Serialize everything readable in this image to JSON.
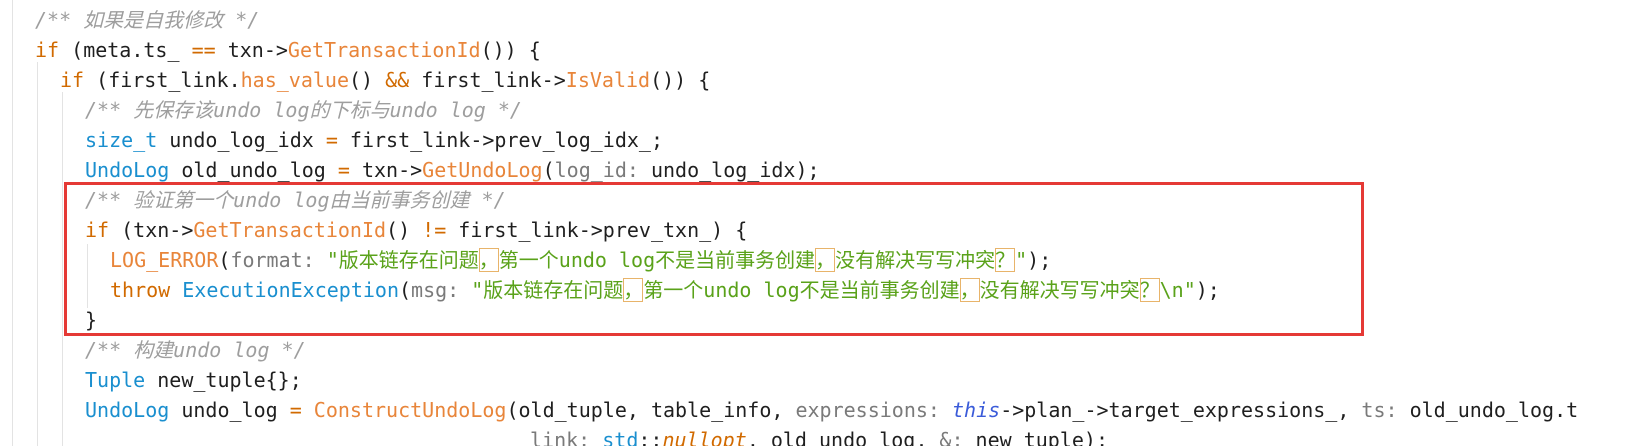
{
  "editor": {
    "lines": [
      [
        {
          "c": "tok-comment",
          "t": "/** 如果是自我修改 */"
        }
      ],
      [
        {
          "c": "tok-kw",
          "t": "if"
        },
        {
          "c": "tok-punct",
          "t": " ("
        },
        {
          "c": "tok-var",
          "t": "meta.ts_ "
        },
        {
          "c": "tok-op",
          "t": "=="
        },
        {
          "c": "tok-var",
          "t": " txn->"
        },
        {
          "c": "tok-fn",
          "t": "GetTransactionId"
        },
        {
          "c": "tok-punct",
          "t": "()) {"
        }
      ],
      [
        {
          "c": "tok-kw",
          "t": "if"
        },
        {
          "c": "tok-punct",
          "t": " ("
        },
        {
          "c": "tok-var",
          "t": "first_link."
        },
        {
          "c": "tok-fn",
          "t": "has_value"
        },
        {
          "c": "tok-punct",
          "t": "() "
        },
        {
          "c": "tok-op",
          "t": "&&"
        },
        {
          "c": "tok-var",
          "t": " first_link->"
        },
        {
          "c": "tok-fn",
          "t": "IsValid"
        },
        {
          "c": "tok-punct",
          "t": "()) {"
        }
      ],
      [
        {
          "c": "tok-comment",
          "t": "/** 先保存该undo log的下标与undo log */"
        }
      ],
      [
        {
          "c": "tok-type",
          "t": "size_t"
        },
        {
          "c": "tok-var",
          "t": " undo_log_idx "
        },
        {
          "c": "tok-op",
          "t": "="
        },
        {
          "c": "tok-var",
          "t": " first_link->prev_log_idx_;"
        }
      ],
      [
        {
          "c": "tok-type",
          "t": "UndoLog"
        },
        {
          "c": "tok-var",
          "t": " old_undo_log "
        },
        {
          "c": "tok-op",
          "t": "="
        },
        {
          "c": "tok-var",
          "t": " txn->"
        },
        {
          "c": "tok-fn",
          "t": "GetUndoLog"
        },
        {
          "c": "tok-punct",
          "t": "("
        },
        {
          "c": "tok-hint",
          "t": "log_id: "
        },
        {
          "c": "tok-var",
          "t": "undo_log_idx);"
        }
      ],
      [
        {
          "c": "tok-comment",
          "t": "/** 验证第一个undo log由当前事务创建 */"
        }
      ],
      [
        {
          "c": "tok-kw",
          "t": "if"
        },
        {
          "c": "tok-punct",
          "t": " (txn->"
        },
        {
          "c": "tok-fn",
          "t": "GetTransactionId"
        },
        {
          "c": "tok-punct",
          "t": "() "
        },
        {
          "c": "tok-op",
          "t": "!="
        },
        {
          "c": "tok-var",
          "t": " first_link->prev_txn_) {"
        }
      ],
      [
        {
          "c": "tok-fn",
          "t": "LOG_ERROR"
        },
        {
          "c": "tok-punct",
          "t": "("
        },
        {
          "c": "tok-hint",
          "t": "format: "
        },
        {
          "c": "tok-str",
          "t": "\"版本链存在问题"
        },
        {
          "c": "tok-str mark",
          "t": "，"
        },
        {
          "c": "tok-str",
          "t": "第一个undo log不是当前事务创建"
        },
        {
          "c": "tok-str mark",
          "t": "，"
        },
        {
          "c": "tok-str",
          "t": "没有解决写写冲突"
        },
        {
          "c": "tok-str mark",
          "t": "？"
        },
        {
          "c": "tok-str",
          "t": "\""
        },
        {
          "c": "tok-punct",
          "t": ");"
        }
      ],
      [
        {
          "c": "tok-kw",
          "t": "throw"
        },
        {
          "c": "tok-type",
          "t": " ExecutionException"
        },
        {
          "c": "tok-punct",
          "t": "("
        },
        {
          "c": "tok-hint",
          "t": "msg: "
        },
        {
          "c": "tok-str",
          "t": "\"版本链存在问题"
        },
        {
          "c": "tok-str mark",
          "t": "，"
        },
        {
          "c": "tok-str",
          "t": "第一个undo log不是当前事务创建"
        },
        {
          "c": "tok-str mark",
          "t": "，"
        },
        {
          "c": "tok-str",
          "t": "没有解决写写冲突"
        },
        {
          "c": "tok-str mark",
          "t": "？"
        },
        {
          "c": "tok-str",
          "t": "\\n\""
        },
        {
          "c": "tok-punct",
          "t": ");"
        }
      ],
      [
        {
          "c": "tok-punct",
          "t": "}"
        }
      ],
      [
        {
          "c": "tok-comment",
          "t": "/** 构建undo log */"
        }
      ],
      [
        {
          "c": "tok-type",
          "t": "Tuple"
        },
        {
          "c": "tok-var",
          "t": " new_tuple{};"
        }
      ],
      [
        {
          "c": "tok-type",
          "t": "UndoLog"
        },
        {
          "c": "tok-var",
          "t": " undo_log "
        },
        {
          "c": "tok-op",
          "t": "="
        },
        {
          "c": "tok-fn",
          "t": " ConstructUndoLog"
        },
        {
          "c": "tok-punct",
          "t": "("
        },
        {
          "c": "tok-var",
          "t": "old_tuple, table_info, "
        },
        {
          "c": "tok-hint",
          "t": "expressions: "
        },
        {
          "c": "tok-this",
          "t": "this"
        },
        {
          "c": "tok-var",
          "t": "->plan_->target_expressions_, "
        },
        {
          "c": "tok-hint",
          "t": "ts: "
        },
        {
          "c": "tok-var",
          "t": "old_undo_log.t"
        }
      ],
      [
        {
          "c": "tok-hint",
          "t": "link: "
        },
        {
          "c": "tok-type",
          "t": "std"
        },
        {
          "c": "tok-punct",
          "t": "::"
        },
        {
          "c": "tok-null",
          "t": "nullopt"
        },
        {
          "c": "tok-var",
          "t": ", old_undo_log, "
        },
        {
          "c": "tok-hint",
          "t": "&: "
        },
        {
          "c": "tok-var",
          "t": "new_tuple);"
        }
      ]
    ]
  }
}
